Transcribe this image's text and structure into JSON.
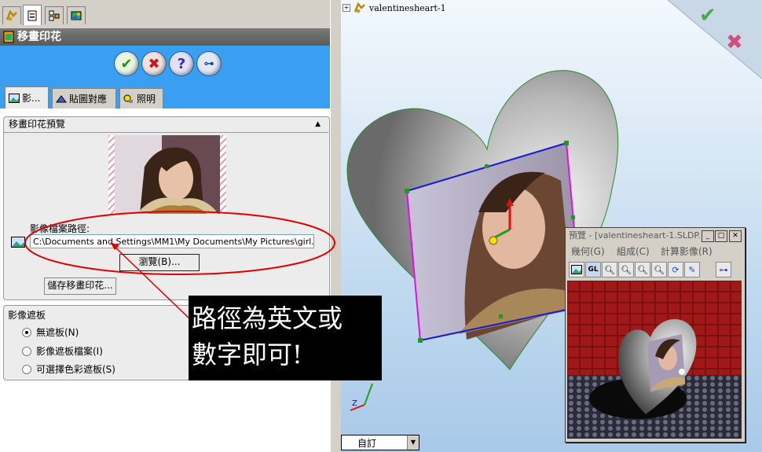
{
  "left_panel": {
    "title": "移畫印花",
    "panel_tabs": [
      "feature-manager-icon",
      "property-manager-icon",
      "configuration-manager-icon",
      "display-manager-icon"
    ],
    "action_buttons": [
      "ok-icon",
      "cancel-icon",
      "help-icon",
      "pushpin-icon"
    ],
    "feature_tabs": [
      {
        "label": "影..."
      },
      {
        "label": "貼圖對應"
      },
      {
        "label": "照明"
      }
    ],
    "preview_section": {
      "header": "移畫印花預覽",
      "path_label": "影像檔案路徑:",
      "path_value": "C:\\Documents and Settings\\MM1\\My Documents\\My Pictures\\girl.jpg",
      "browse_label": "瀏覽(B)...",
      "save_label": "儲存移畫印花..."
    },
    "mask_section": {
      "header": "影像遮板",
      "options": [
        {
          "label": "無遮板(N)",
          "selected": true
        },
        {
          "label": "影像遮板檔案(I)",
          "selected": false
        },
        {
          "label": "可選擇色彩遮板(S)",
          "selected": false
        }
      ]
    }
  },
  "graphics": {
    "tree_item": "valentinesheart-1",
    "confirm": [
      "confirm-ok-icon",
      "confirm-cancel-icon"
    ],
    "view_dropdown": "自訂"
  },
  "annotation": {
    "line1": "路徑為英文或",
    "line2": "數字即可!"
  },
  "preview_window": {
    "title": "預覽 - [valentinesheart-1.SLDP...",
    "menu": [
      "幾何(G)",
      "組成(C)",
      "計算影像(R)"
    ],
    "tools": [
      "image-icon",
      "gl-icon",
      "zoom-in-icon",
      "zoom-out-icon",
      "zoom-fit-icon",
      "zoom-area-icon",
      "rotate-icon",
      "tool-icon",
      "pin-icon"
    ]
  },
  "colors": {
    "title_bar": "#5a5a5a",
    "accent_blue": "#3a9ff0",
    "annotation_red": "#e00000"
  }
}
